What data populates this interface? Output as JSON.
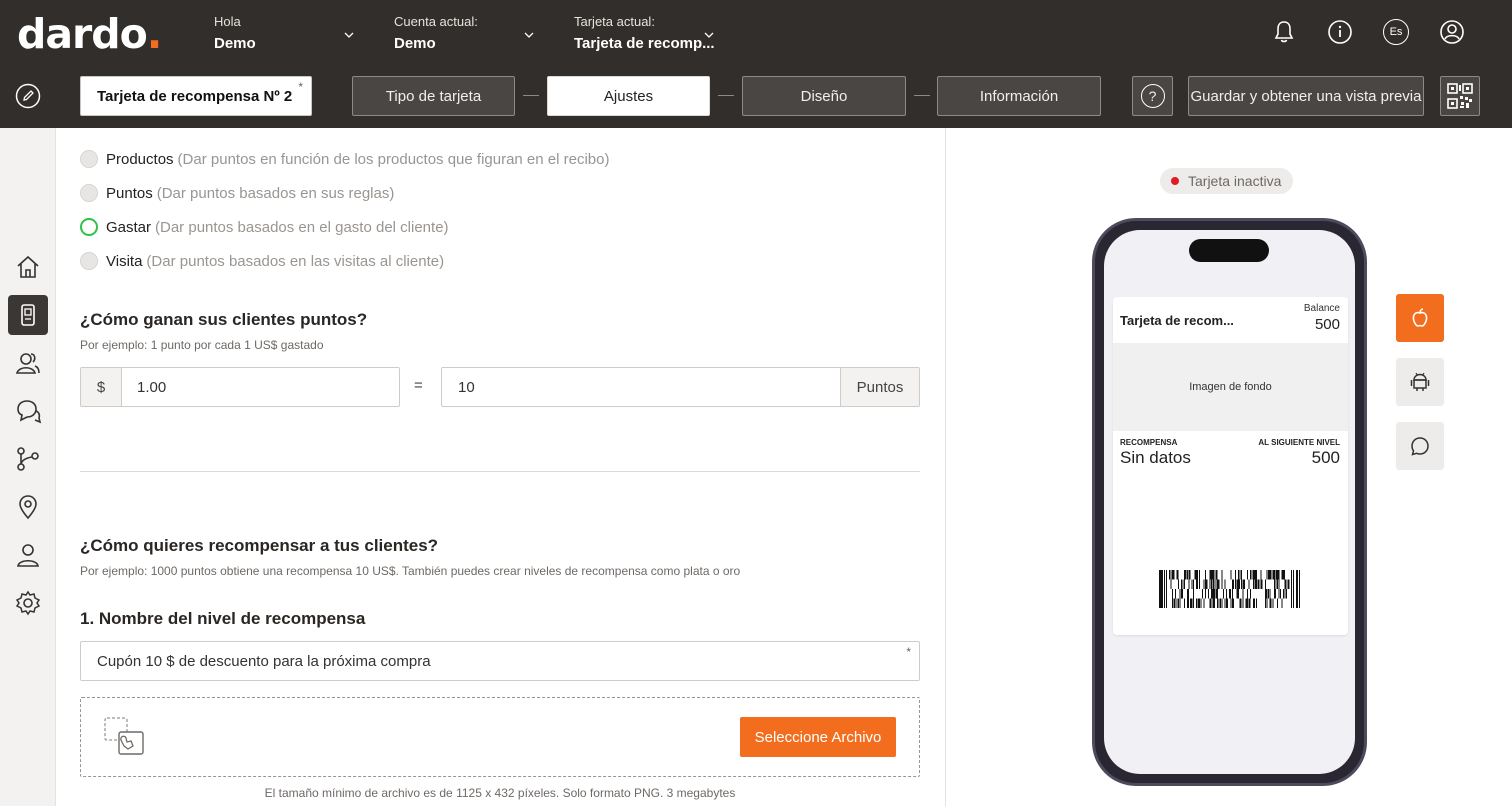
{
  "brand": {
    "logo_main": "dardo",
    "logo_dot": ".",
    "accent": "#f26d1d",
    "success": "#2ec24b",
    "alert": "#e01b24"
  },
  "header": {
    "greeting_label": "Hola",
    "greeting_value": "Demo",
    "account_label": "Cuenta actual:",
    "account_value": "Demo",
    "card_label": "Tarjeta actual:",
    "card_value": "Tarjeta de recomp...",
    "icons": [
      "bell-icon",
      "info-icon",
      "language-icon",
      "user-icon"
    ],
    "language": "Es"
  },
  "toolbar": {
    "card_name": "Tarjeta de recompensa Nº 2",
    "required_mark": "*",
    "steps": [
      {
        "label": "Tipo de tarjeta",
        "active": false
      },
      {
        "label": "Ajustes",
        "active": true
      },
      {
        "label": "Diseño",
        "active": false
      },
      {
        "label": "Información",
        "active": false
      }
    ],
    "help": "?",
    "save_label": "Guardar y obtener una vista previa"
  },
  "sidebar": {
    "items": [
      "home-icon",
      "card-icon",
      "clients-icon",
      "chat-icon",
      "flows-icon",
      "location-icon",
      "profile-icon",
      "settings-icon"
    ],
    "active_index": 1
  },
  "mechanics": {
    "options": [
      {
        "label": "Productos",
        "desc": "(Dar puntos en función de los productos que figuran en el recibo)",
        "selected": false
      },
      {
        "label": "Puntos",
        "desc": "(Dar puntos basados en sus reglas)",
        "selected": false
      },
      {
        "label": "Gastar",
        "desc": "(Dar puntos basados en el gasto del cliente)",
        "selected": true
      },
      {
        "label": "Visita",
        "desc": "(Dar puntos basados en las visitas al cliente)",
        "selected": false
      }
    ]
  },
  "earn": {
    "title": "¿Cómo ganan sus clientes puntos?",
    "hint": "Por ejemplo: 1 punto por cada 1 US$ gastado",
    "currency": "$",
    "amount": "1.00",
    "equals": "=",
    "points": "10",
    "points_unit": "Puntos"
  },
  "reward": {
    "title": "¿Cómo quieres recompensar a tus clientes?",
    "hint": "Por ejemplo: 1000 puntos obtiene una recompensa 10 US$. También puedes crear niveles de recompensa como plata o oro",
    "level_title": "1. Nombre del nivel de recompensa",
    "level_name": "Cupón 10 $ de descuento para la próxima compra",
    "required_mark": "*",
    "file_button": "Seleccione Archivo",
    "file_note": "El tamaño mínimo de archivo es de 1125 x 432 píxeles. Solo formato PNG. 3 megabytes"
  },
  "preview": {
    "status": "Tarjeta inactiva",
    "card": {
      "title": "Tarjeta de recom...",
      "balance_label": "Balance",
      "balance_value": "500",
      "image_placeholder": "Imagen de fondo",
      "reward_label": "RECOMPENSA",
      "reward_value": "Sin datos",
      "next_label": "AL SIGUIENTE NIVEL",
      "next_value": "500"
    },
    "platforms": [
      "apple-icon",
      "android-icon",
      "chat-icon"
    ],
    "active_platform": "apple-icon"
  }
}
